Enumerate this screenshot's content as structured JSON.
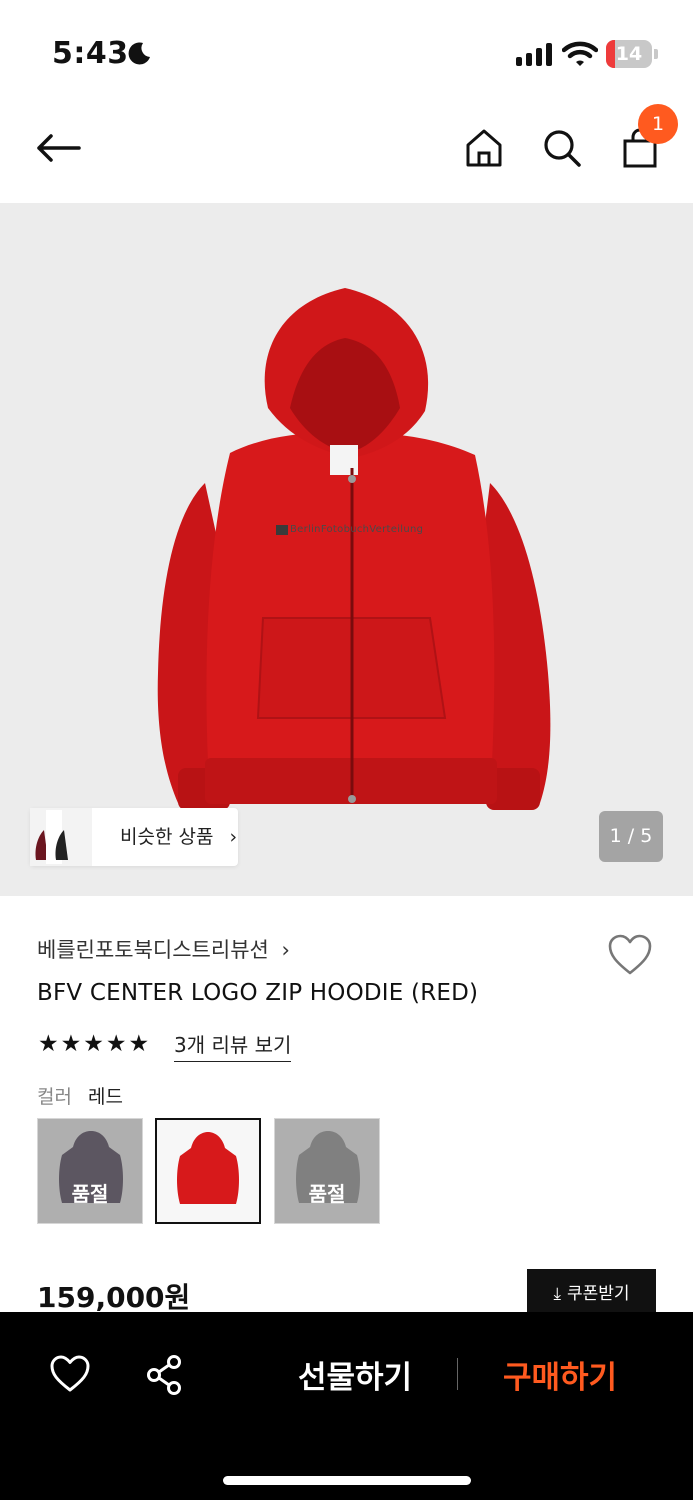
{
  "status": {
    "time": "5:43",
    "battery": "14",
    "icons": [
      "moon-icon",
      "signal-icon",
      "wifi-icon",
      "battery-icon"
    ]
  },
  "nav": {
    "icons": [
      "back-arrow-icon",
      "home-icon",
      "search-icon",
      "shopping-bag-icon"
    ],
    "cart_count": "1"
  },
  "hero": {
    "similar_label": "비슷한 상품",
    "pager": "1 / 5",
    "print_text": "BerlinFotobuchVerteilung"
  },
  "product": {
    "brand": "베를린포토북디스트리뷰션",
    "brand_chevron": "›",
    "title": "BFV CENTER LOGO ZIP HOODIE (RED)",
    "rating_stars": 5,
    "reviews_link": "3개 리뷰 보기",
    "color_label": "컬러",
    "color_value": "레드",
    "swatches": [
      {
        "color": "purple",
        "sold_out_label": "품절"
      },
      {
        "color": "red",
        "selected": true
      },
      {
        "color": "gray",
        "sold_out_label": "품절"
      }
    ],
    "price": "159,000원",
    "coupon_label": "쿠폰받기"
  },
  "bottom_bar": {
    "gift_label": "선물하기",
    "buy_label": "구매하기",
    "icons": [
      "heart-outline-icon",
      "share-icon"
    ]
  },
  "colors": {
    "accent": "#ff5a1f",
    "hoodie_red": "#d7191b",
    "bottom_bar": "#000000"
  }
}
